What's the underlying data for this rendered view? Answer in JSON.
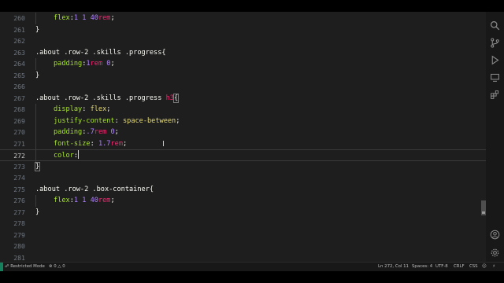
{
  "editor": {
    "current_line": "272",
    "lines": [
      {
        "n": "260",
        "indent": true,
        "tokens": [
          {
            "t": "flex",
            "c": "t-prop"
          },
          {
            "t": ":",
            "c": "t-punc"
          },
          {
            "t": "1 1 40",
            "c": "t-num"
          },
          {
            "t": "rem",
            "c": "t-unit"
          },
          {
            "t": ";",
            "c": "t-punc"
          }
        ]
      },
      {
        "n": "261",
        "indent": false,
        "tokens": [
          {
            "t": "}",
            "c": "t-punc"
          }
        ]
      },
      {
        "n": "262",
        "indent": false,
        "tokens": []
      },
      {
        "n": "263",
        "indent": false,
        "tokens": [
          {
            "t": ".about .row-2 .skills .progress",
            "c": "t-sel"
          },
          {
            "t": "{",
            "c": "t-punc"
          }
        ]
      },
      {
        "n": "264",
        "indent": true,
        "tokens": [
          {
            "t": "padding",
            "c": "t-prop"
          },
          {
            "t": ":",
            "c": "t-punc"
          },
          {
            "t": "1",
            "c": "t-num"
          },
          {
            "t": "rem",
            "c": "t-unit"
          },
          {
            "t": " 0",
            "c": "t-num"
          },
          {
            "t": ";",
            "c": "t-punc"
          }
        ]
      },
      {
        "n": "265",
        "indent": false,
        "tokens": [
          {
            "t": "}",
            "c": "t-punc"
          }
        ]
      },
      {
        "n": "266",
        "indent": false,
        "tokens": []
      },
      {
        "n": "267",
        "indent": false,
        "tokens": [
          {
            "t": ".about .row-2 .skills .progress ",
            "c": "t-sel"
          },
          {
            "t": "h3",
            "c": "t-tag"
          },
          {
            "t": "{",
            "c": "t-punc br-hl"
          }
        ]
      },
      {
        "n": "268",
        "indent": true,
        "tokens": [
          {
            "t": "display",
            "c": "t-prop"
          },
          {
            "t": ": ",
            "c": "t-punc"
          },
          {
            "t": "flex",
            "c": "t-val"
          },
          {
            "t": ";",
            "c": "t-punc"
          }
        ]
      },
      {
        "n": "269",
        "indent": true,
        "tokens": [
          {
            "t": "justify-content",
            "c": "t-prop"
          },
          {
            "t": ": ",
            "c": "t-punc"
          },
          {
            "t": "space-between",
            "c": "t-val"
          },
          {
            "t": ";",
            "c": "t-punc"
          }
        ]
      },
      {
        "n": "270",
        "indent": true,
        "tokens": [
          {
            "t": "padding",
            "c": "t-prop"
          },
          {
            "t": ":",
            "c": "t-punc"
          },
          {
            "t": ".7",
            "c": "t-num"
          },
          {
            "t": "rem",
            "c": "t-unit"
          },
          {
            "t": " 0",
            "c": "t-num"
          },
          {
            "t": ";",
            "c": "t-punc"
          }
        ]
      },
      {
        "n": "271",
        "indent": true,
        "tokens": [
          {
            "t": "font-size",
            "c": "t-prop"
          },
          {
            "t": ": ",
            "c": "t-punc"
          },
          {
            "t": "1.7",
            "c": "t-num"
          },
          {
            "t": "rem",
            "c": "t-unit"
          },
          {
            "t": ";",
            "c": "t-punc"
          }
        ]
      },
      {
        "n": "272",
        "indent": true,
        "caret": true,
        "tokens": [
          {
            "t": "color",
            "c": "t-prop"
          },
          {
            "t": ":",
            "c": "t-punc"
          }
        ]
      },
      {
        "n": "273",
        "indent": false,
        "tokens": [
          {
            "t": "}",
            "c": "t-punc br-hl"
          }
        ]
      },
      {
        "n": "274",
        "indent": false,
        "tokens": []
      },
      {
        "n": "275",
        "indent": false,
        "tokens": [
          {
            "t": ".about .row-2 .box-container",
            "c": "t-sel"
          },
          {
            "t": "{",
            "c": "t-punc"
          }
        ]
      },
      {
        "n": "276",
        "indent": true,
        "tokens": [
          {
            "t": "flex",
            "c": "t-prop"
          },
          {
            "t": ":",
            "c": "t-punc"
          },
          {
            "t": "1 1 40",
            "c": "t-num"
          },
          {
            "t": "rem",
            "c": "t-unit"
          },
          {
            "t": ";",
            "c": "t-punc"
          }
        ]
      },
      {
        "n": "277",
        "indent": false,
        "tokens": [
          {
            "t": "}",
            "c": "t-punc"
          }
        ]
      },
      {
        "n": "278",
        "indent": false,
        "tokens": []
      },
      {
        "n": "279",
        "indent": false,
        "tokens": []
      },
      {
        "n": "280",
        "indent": false,
        "tokens": []
      },
      {
        "n": "281",
        "indent": false,
        "tokens": []
      }
    ]
  },
  "activity_bar": {
    "top_icons": [
      "search-icon",
      "source-control-icon",
      "run-debug-icon",
      "remote-explorer-icon",
      "extensions-icon"
    ],
    "bottom_icons": [
      "account-icon",
      "manage-gear-icon"
    ]
  },
  "status_bar": {
    "restricted_mode": "Restricted Mode",
    "errors": "0",
    "warnings": "0",
    "cursor_position": "Ln 272, Col 11",
    "spaces": "Spaces: 4",
    "encoding": "UTF-8",
    "eol": "CRLF",
    "language": "CSS"
  },
  "colors": {
    "editor_bg": "#1e1e1e",
    "property": "#a6e22e",
    "number": "#ae81ff",
    "unit": "#f92672",
    "string_value": "#e6db74",
    "selector": "#f8f8f2",
    "remote_indicator": "#16825d"
  }
}
